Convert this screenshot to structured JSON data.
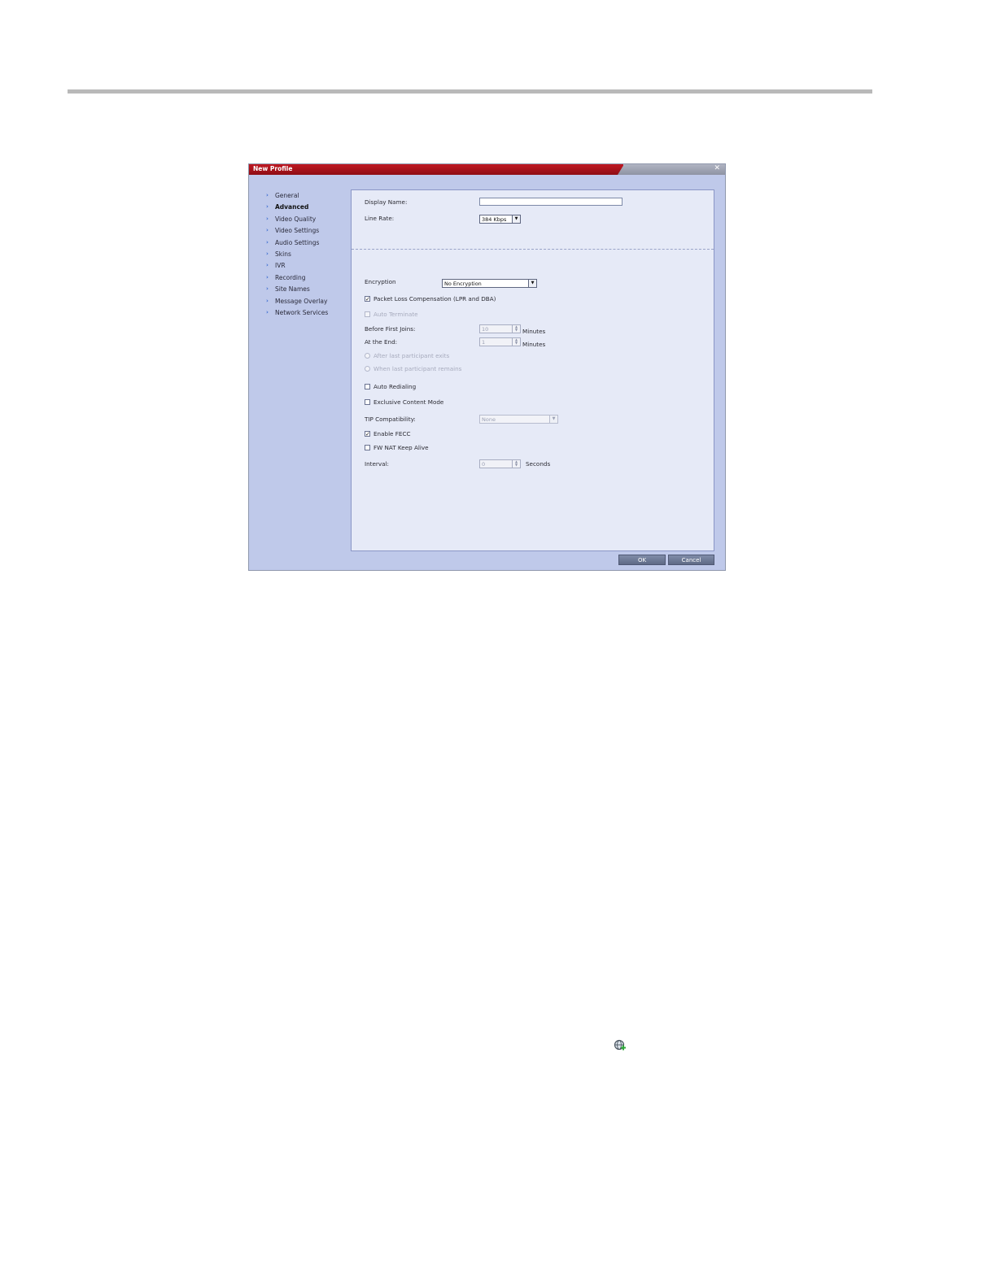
{
  "dialog": {
    "title": "New Profile",
    "close_glyph": "✕",
    "nav_items": [
      {
        "label": "General",
        "active": false
      },
      {
        "label": "Advanced",
        "active": true
      },
      {
        "label": "Video Quality",
        "active": false
      },
      {
        "label": "Video Settings",
        "active": false
      },
      {
        "label": "Audio Settings",
        "active": false
      },
      {
        "label": "Skins",
        "active": false
      },
      {
        "label": "IVR",
        "active": false
      },
      {
        "label": "Recording",
        "active": false
      },
      {
        "label": "Site Names",
        "active": false
      },
      {
        "label": "Message Overlay",
        "active": false
      },
      {
        "label": "Network Services",
        "active": false
      }
    ],
    "form": {
      "display_name_label": "Display Name:",
      "display_name_value": "",
      "line_rate_label": "Line Rate:",
      "line_rate_value": "384 Kbps",
      "encryption_label": "Encryption",
      "encryption_value": "No Encryption",
      "packet_loss_label": "Packet Loss Compensation (LPR and DBA)",
      "packet_loss_checked": true,
      "auto_terminate_label": "Auto Terminate",
      "before_first_joins_label": "Before First Joins:",
      "before_first_joins_value": "10",
      "at_the_end_label": "At the End:",
      "at_the_end_value": "1",
      "minutes_unit": "Minutes",
      "after_last_exits_label": "After last participant exits",
      "when_last_remains_label": "When last participant remains",
      "auto_redialing_label": "Auto Redialing",
      "exclusive_content_label": "Exclusive Content Mode",
      "tip_label": "TIP Compatibility:",
      "tip_value": "None",
      "enable_fecc_label": "Enable FECC",
      "enable_fecc_checked": true,
      "fw_nat_label": "FW NAT Keep Alive",
      "interval_label": "Interval:",
      "interval_value": "0",
      "seconds_unit": "Seconds"
    },
    "buttons": {
      "ok": "OK",
      "cancel": "Cancel"
    }
  },
  "icons": {
    "globe_add": "globe-add-icon",
    "accent_green": "#2fa83a"
  }
}
